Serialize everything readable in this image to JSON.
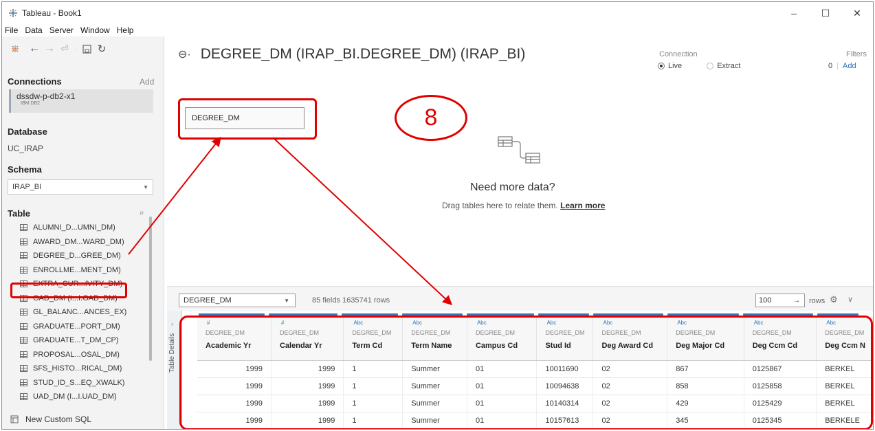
{
  "window": {
    "title": "Tableau - Book1",
    "minimize": "–",
    "maximize": "☐",
    "close": "✕"
  },
  "menu": [
    "File",
    "Data",
    "Server",
    "Window",
    "Help"
  ],
  "sidebar": {
    "connections_header": "Connections",
    "connections_add": "Add",
    "connection": {
      "name": "dssdw-p-db2-x1",
      "type": "IBM DB2"
    },
    "database_header": "Database",
    "database_value": "UC_IRAP",
    "schema_header": "Schema",
    "schema_value": "IRAP_BI",
    "table_header": "Table",
    "tables": [
      "ALUMNI_D...UMNI_DM)",
      "AWARD_DM...WARD_DM)",
      "DEGREE_D...GREE_DM)",
      "ENROLLME...MENT_DM)",
      "EXTRA_CUR...IVITY_DM)",
      "GAD_DM (I...I.GAD_DM)",
      "GL_BALANC...ANCES_EX)",
      "GRADUATE...PORT_DM)",
      "GRADUATE...T_DM_CP)",
      "PROPOSAL...OSAL_DM)",
      "SFS_HISTO...RICAL_DM)",
      "STUD_ID_S...EQ_XWALK)",
      "UAD_DM (I...I.UAD_DM)"
    ],
    "custom_sql": "New Custom SQL"
  },
  "canvas": {
    "datasource_title": "DEGREE_DM (IRAP_BI.DEGREE_DM) (IRAP_BI)",
    "connection_label": "Connection",
    "live_label": "Live",
    "extract_label": "Extract",
    "filters_label": "Filters",
    "filters_count": "0",
    "filters_add": "Add",
    "table_chip": "DEGREE_DM",
    "annotation_number": "8",
    "more_title": "Need more data?",
    "more_sub": "Drag tables here to relate them.",
    "more_link": "Learn more"
  },
  "grid_toolbar": {
    "table_select": "DEGREE_DM",
    "info": "85 fields 1635741 rows",
    "rows_value": "100",
    "rows_label": "rows"
  },
  "grid": {
    "side_label": "Table Details",
    "columns": [
      {
        "type": "#",
        "source": "DEGREE_DM",
        "name": "Academic Yr"
      },
      {
        "type": "#",
        "source": "DEGREE_DM",
        "name": "Calendar Yr"
      },
      {
        "type": "Abc",
        "source": "DEGREE_DM",
        "name": "Term Cd"
      },
      {
        "type": "Abc",
        "source": "DEGREE_DM",
        "name": "Term Name"
      },
      {
        "type": "Abc",
        "source": "DEGREE_DM",
        "name": "Campus Cd"
      },
      {
        "type": "Abc",
        "source": "DEGREE_DM",
        "name": "Stud Id"
      },
      {
        "type": "Abc",
        "source": "DEGREE_DM",
        "name": "Deg Award Cd"
      },
      {
        "type": "Abc",
        "source": "DEGREE_DM",
        "name": "Deg Major Cd"
      },
      {
        "type": "Abc",
        "source": "DEGREE_DM",
        "name": "Deg Ccm Cd"
      },
      {
        "type": "Abc",
        "source": "DEGREE_DM",
        "name": "Deg Ccm N"
      }
    ],
    "rows": [
      [
        "1999",
        "1999",
        "1",
        "Summer",
        "01",
        "10011690",
        "02",
        "867",
        "0125867",
        "BERKEL"
      ],
      [
        "1999",
        "1999",
        "1",
        "Summer",
        "01",
        "10094638",
        "02",
        "858",
        "0125858",
        "BERKEL"
      ],
      [
        "1999",
        "1999",
        "1",
        "Summer",
        "01",
        "10140314",
        "02",
        "429",
        "0125429",
        "BERKEL"
      ],
      [
        "1999",
        "1999",
        "1",
        "Summer",
        "01",
        "10157613",
        "02",
        "345",
        "0125345",
        "BERKELE"
      ]
    ]
  },
  "colors": {
    "annotation_red": "#e00000",
    "accent_blue": "#3a74b5"
  }
}
